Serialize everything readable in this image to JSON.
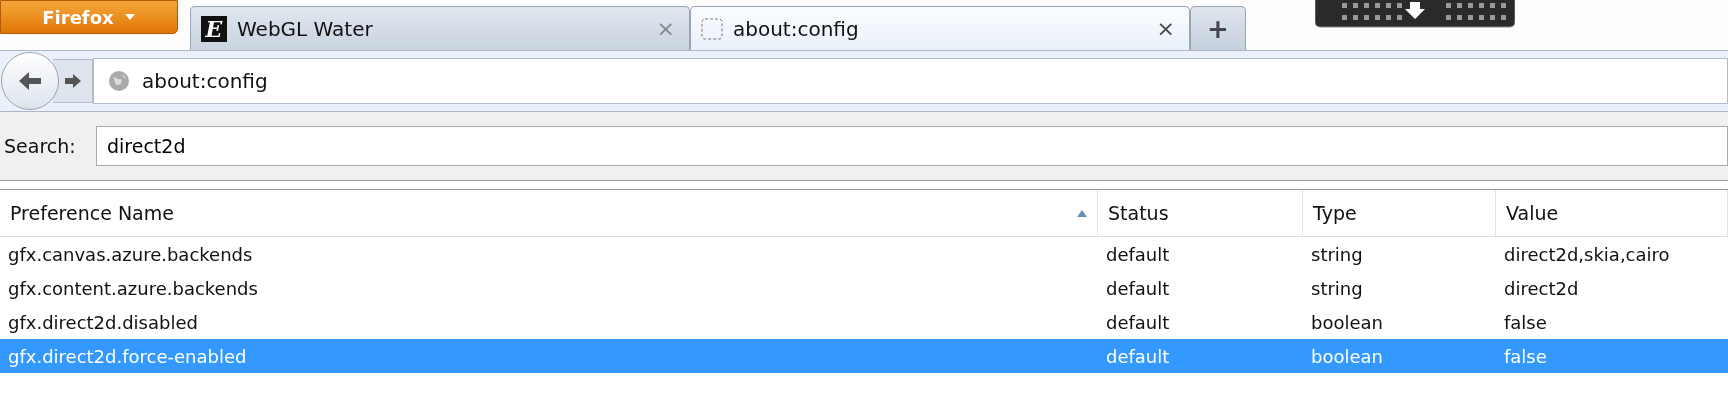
{
  "app_menu": {
    "label": "Firefox"
  },
  "tabs": [
    {
      "title": "WebGL Water",
      "selected": false,
      "kind": "letter",
      "icon_text": "E",
      "close": "×"
    },
    {
      "title": "about:config",
      "selected": true,
      "kind": "blank",
      "close": "×"
    }
  ],
  "new_tab": "+",
  "address_bar": {
    "value": "about:config"
  },
  "search": {
    "label": "Search:",
    "value": "direct2d"
  },
  "table": {
    "columns": [
      {
        "label": "Preference Name",
        "sorted": true
      },
      {
        "label": "Status",
        "sorted": false
      },
      {
        "label": "Type",
        "sorted": false
      },
      {
        "label": "Value",
        "sorted": false
      }
    ],
    "rows": [
      {
        "cells": [
          "gfx.canvas.azure.backends",
          "default",
          "string",
          "direct2d,skia,cairo"
        ],
        "selected": false
      },
      {
        "cells": [
          "gfx.content.azure.backends",
          "default",
          "string",
          "direct2d"
        ],
        "selected": false
      },
      {
        "cells": [
          "gfx.direct2d.disabled",
          "default",
          "boolean",
          "false"
        ],
        "selected": false
      },
      {
        "cells": [
          "gfx.direct2d.force-enabled",
          "default",
          "boolean",
          "false"
        ],
        "selected": true
      }
    ]
  }
}
